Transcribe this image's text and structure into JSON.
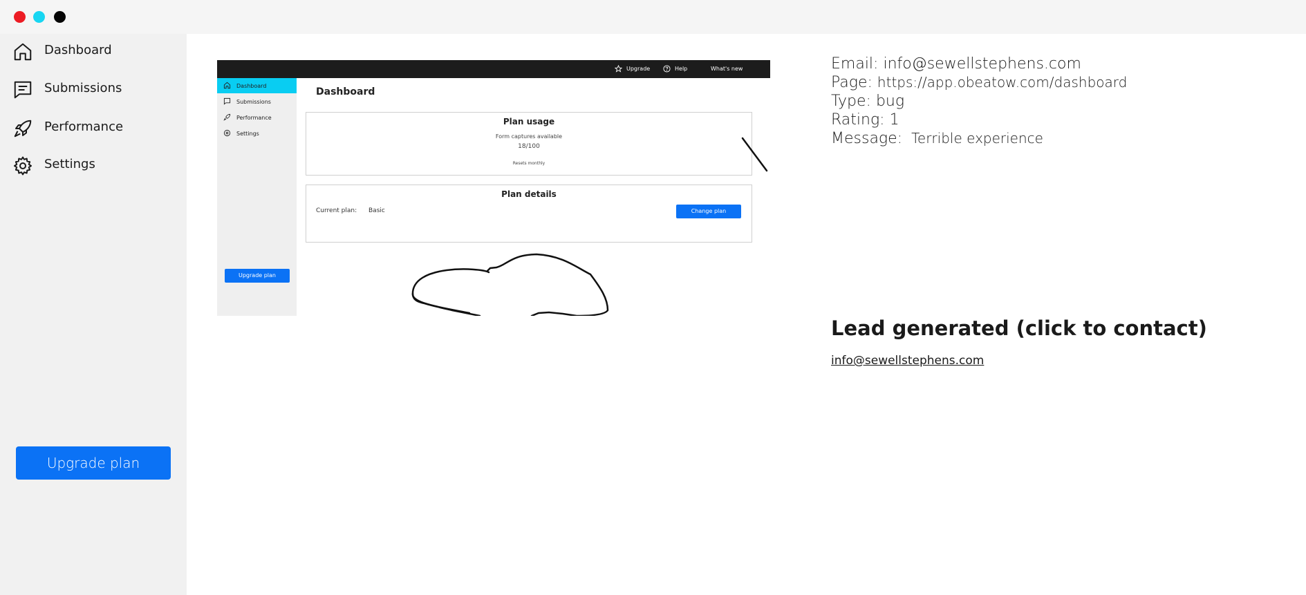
{
  "window": {
    "controls": [
      "close",
      "minimize",
      "maximize"
    ]
  },
  "sidebar": {
    "items": [
      {
        "label": "Dashboard",
        "icon": "home-icon"
      },
      {
        "label": "Submissions",
        "icon": "message-square-icon"
      },
      {
        "label": "Performance",
        "icon": "rocket-icon"
      },
      {
        "label": "Settings",
        "icon": "gear-icon"
      }
    ],
    "upgrade_label": "Upgrade plan"
  },
  "screenshot": {
    "topbar": {
      "upgrade": "Upgrade",
      "help": "Help",
      "whats_new": "What's new"
    },
    "sidebar": {
      "items": [
        {
          "label": "Dashboard",
          "icon": "home-icon"
        },
        {
          "label": "Submissions",
          "icon": "message-square-icon"
        },
        {
          "label": "Performance",
          "icon": "rocket-icon"
        },
        {
          "label": "Settings",
          "icon": "gear-icon"
        }
      ],
      "upgrade_label": "Upgrade plan"
    },
    "title": "Dashboard",
    "plan_usage": {
      "title": "Plan usage",
      "caption": "Form captures available",
      "count": "18/100",
      "reset": "Resets monthly"
    },
    "plan_details": {
      "title": "Plan details",
      "current_label": "Current plan:",
      "current_value": "Basic",
      "change_label": "Change plan"
    }
  },
  "feedback": {
    "email_label": "Email:",
    "email": "info@sewellstephens.com",
    "page_label": "Page:",
    "page": "https://app.obeatow.com/dashboard",
    "type_label": "Type:",
    "type": "bug",
    "rating_label": "Rating:",
    "rating": "1",
    "message_label": "Message:",
    "message": "Terrible experience"
  },
  "lead": {
    "title": "Lead generated (click to contact)",
    "email": "info@sewellstephens.com"
  },
  "colors": {
    "accent": "#0b72f5",
    "active_cyan": "#09cdf2",
    "close": "#ec1c24",
    "minimize": "#18d6f2",
    "maximize": "#050505"
  }
}
